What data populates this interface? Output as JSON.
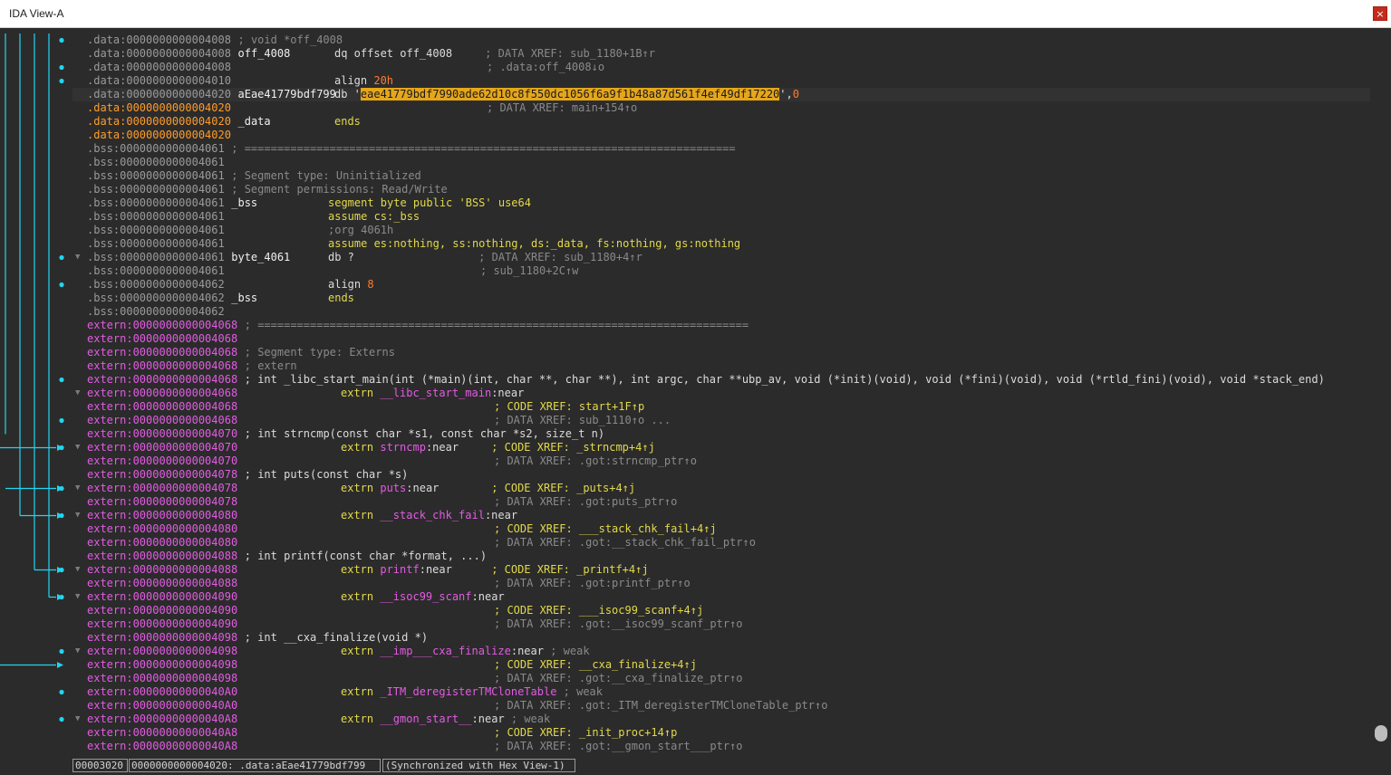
{
  "window": {
    "title": "IDA View-A",
    "close_glyph": "×"
  },
  "arrow_color": "#1fd6f0",
  "lines": [
    {
      "addr": ".data:0000000000004008",
      "addr_style": "data",
      "dot": true,
      "segs": [
        {
          "t": "; void *off_4008",
          "c": "cmt"
        }
      ]
    },
    {
      "addr": ".data:0000000000004008",
      "addr_style": "data",
      "dot": false,
      "label": "off_4008",
      "segs": [
        {
          "t": "dq offset off_4008",
          "c": "mn"
        },
        {
          "t": "; DATA XREF: sub_1180+1B↑r",
          "c": "cmt"
        }
      ]
    },
    {
      "addr": ".data:0000000000004008",
      "addr_style": "data",
      "dot": true,
      "segs": [
        {
          "t": "; .data:off_4008↓o",
          "c": "cmt"
        }
      ]
    },
    {
      "addr": ".data:0000000000004010",
      "addr_style": "data",
      "dot": true,
      "segs": [
        {
          "t": "align ",
          "c": "mn"
        },
        {
          "t": "20h",
          "c": "num"
        }
      ]
    },
    {
      "addr": ".data:0000000000004020",
      "addr_style": "data",
      "dot": false,
      "current": true,
      "label": "aEae41779bdf799",
      "segs": [
        {
          "t": "db '",
          "c": "mn"
        },
        {
          "t": "eae41779bdf7990ade62d10c8f550dc1056f6a9f1b48a87d561f4ef49df17220",
          "c": "hl"
        },
        {
          "t": "',",
          "c": "mn"
        },
        {
          "t": "0",
          "c": "num"
        }
      ]
    },
    {
      "addr": ".data:0000000000004020",
      "addr_style": "orange",
      "dot": false,
      "segs": [
        {
          "t": "; DATA XREF: main+154↑o",
          "c": "cmt"
        }
      ]
    },
    {
      "addr": ".data:0000000000004020",
      "addr_style": "orange",
      "dot": false,
      "label": "_data",
      "segs": [
        {
          "t": "ends",
          "c": "kw"
        }
      ]
    },
    {
      "addr": ".data:0000000000004020",
      "addr_style": "orange",
      "dot": false,
      "segs": []
    },
    {
      "addr": ".bss:0000000000004061",
      "addr_style": "data",
      "dot": false,
      "segs": [
        {
          "t": "; ===========================================================================",
          "c": "cmt"
        }
      ]
    },
    {
      "addr": ".bss:0000000000004061",
      "addr_style": "data",
      "dot": false,
      "segs": []
    },
    {
      "addr": ".bss:0000000000004061",
      "addr_style": "data",
      "dot": false,
      "segs": [
        {
          "t": "; Segment type: Uninitialized",
          "c": "cmt"
        }
      ]
    },
    {
      "addr": ".bss:0000000000004061",
      "addr_style": "data",
      "dot": false,
      "segs": [
        {
          "t": "; Segment permissions: Read/Write",
          "c": "cmt"
        }
      ]
    },
    {
      "addr": ".bss:0000000000004061",
      "addr_style": "data",
      "dot": false,
      "label": "_bss",
      "segs": [
        {
          "t": "segment byte public 'BSS' use64",
          "c": "kw"
        }
      ]
    },
    {
      "addr": ".bss:0000000000004061",
      "addr_style": "data",
      "dot": false,
      "segs": [
        {
          "t": "assume cs:_bss",
          "c": "kw"
        }
      ]
    },
    {
      "addr": ".bss:0000000000004061",
      "addr_style": "data",
      "dot": false,
      "segs": [
        {
          "t": ";org 4061h",
          "c": "cmt"
        }
      ]
    },
    {
      "addr": ".bss:0000000000004061",
      "addr_style": "data",
      "dot": false,
      "segs": [
        {
          "t": "assume es:nothing, ss:nothing, ds:_data, fs:nothing, gs:nothing",
          "c": "kw"
        }
      ]
    },
    {
      "addr": ".bss:0000000000004061",
      "addr_style": "data",
      "dot": true,
      "fold": true,
      "label": "byte_4061",
      "segs": [
        {
          "t": "db ?",
          "c": "mn"
        },
        {
          "t": "; DATA XREF: sub_1180+4↑r",
          "c": "cmt"
        }
      ]
    },
    {
      "addr": ".bss:0000000000004061",
      "addr_style": "data",
      "dot": false,
      "segs": [
        {
          "t": "; sub_1180+2C↑w",
          "c": "cmt"
        }
      ]
    },
    {
      "addr": ".bss:0000000000004062",
      "addr_style": "data",
      "dot": true,
      "segs": [
        {
          "t": "align ",
          "c": "mn"
        },
        {
          "t": "8",
          "c": "num"
        }
      ]
    },
    {
      "addr": ".bss:0000000000004062",
      "addr_style": "data",
      "dot": false,
      "label": "_bss",
      "segs": [
        {
          "t": "ends",
          "c": "kw"
        }
      ]
    },
    {
      "addr": ".bss:0000000000004062",
      "addr_style": "data",
      "dot": false,
      "segs": []
    },
    {
      "addr": "extern:0000000000004068",
      "addr_style": "extern",
      "dot": false,
      "segs": [
        {
          "t": "; ===========================================================================",
          "c": "cmt"
        }
      ]
    },
    {
      "addr": "extern:0000000000004068",
      "addr_style": "extern",
      "dot": false,
      "segs": []
    },
    {
      "addr": "extern:0000000000004068",
      "addr_style": "extern",
      "dot": false,
      "segs": [
        {
          "t": "; Segment type: Externs",
          "c": "cmt"
        }
      ]
    },
    {
      "addr": "extern:0000000000004068",
      "addr_style": "extern",
      "dot": false,
      "segs": [
        {
          "t": "; extern",
          "c": "cmt"
        }
      ]
    },
    {
      "addr": "extern:0000000000004068",
      "addr_style": "extern",
      "dot": true,
      "segs": [
        {
          "t": "; int _libc_start_main(int (*main)(int, char **, char **), int argc, char **ubp_av, void (*init)(void), void (*fini)(void), void (*rtld_fini)(void), void *stack_end)",
          "c": "decl"
        }
      ]
    },
    {
      "addr": "extern:0000000000004068",
      "addr_style": "extern",
      "dot": false,
      "fold": true,
      "segs": [
        {
          "t": "extrn ",
          "c": "kw"
        },
        {
          "t": "__libc_start_main",
          "c": "mag"
        },
        {
          "t": ":near",
          "c": "mn"
        }
      ]
    },
    {
      "addr": "extern:0000000000004068",
      "addr_style": "extern",
      "dot": false,
      "segs": [
        {
          "t": "; CODE XREF: start+1F↑p",
          "c": "xref"
        }
      ]
    },
    {
      "addr": "extern:0000000000004068",
      "addr_style": "extern",
      "dot": true,
      "segs": [
        {
          "t": "; DATA XREF: sub_1110↑o ...",
          "c": "cmt"
        }
      ]
    },
    {
      "addr": "extern:0000000000004070",
      "addr_style": "extern",
      "dot": false,
      "segs": [
        {
          "t": "; int strncmp(const char *s1, const char *s2, size_t n)",
          "c": "decl"
        }
      ]
    },
    {
      "addr": "extern:0000000000004070",
      "addr_style": "extern",
      "dot": true,
      "fold": true,
      "segs": [
        {
          "t": "extrn ",
          "c": "kw"
        },
        {
          "t": "strncmp",
          "c": "mag"
        },
        {
          "t": ":near",
          "c": "mn"
        },
        {
          "t": "; CODE XREF: _strncmp+4↑j",
          "c": "xref"
        }
      ]
    },
    {
      "addr": "extern:0000000000004070",
      "addr_style": "extern",
      "dot": false,
      "segs": [
        {
          "t": "; DATA XREF: .got:strncmp_ptr↑o",
          "c": "cmt"
        }
      ]
    },
    {
      "addr": "extern:0000000000004078",
      "addr_style": "extern",
      "dot": false,
      "segs": [
        {
          "t": "; int puts(const char *s)",
          "c": "decl"
        }
      ]
    },
    {
      "addr": "extern:0000000000004078",
      "addr_style": "extern",
      "dot": true,
      "fold": true,
      "segs": [
        {
          "t": "extrn ",
          "c": "kw"
        },
        {
          "t": "puts",
          "c": "mag"
        },
        {
          "t": ":near",
          "c": "mn"
        },
        {
          "t": "; CODE XREF: _puts+4↑j",
          "c": "xref"
        }
      ]
    },
    {
      "addr": "extern:0000000000004078",
      "addr_style": "extern",
      "dot": false,
      "segs": [
        {
          "t": "; DATA XREF: .got:puts_ptr↑o",
          "c": "cmt"
        }
      ]
    },
    {
      "addr": "extern:0000000000004080",
      "addr_style": "extern",
      "dot": true,
      "fold": true,
      "segs": [
        {
          "t": "extrn ",
          "c": "kw"
        },
        {
          "t": "__stack_chk_fail",
          "c": "mag"
        },
        {
          "t": ":near",
          "c": "mn"
        }
      ]
    },
    {
      "addr": "extern:0000000000004080",
      "addr_style": "extern",
      "dot": false,
      "segs": [
        {
          "t": "; CODE XREF: ___stack_chk_fail+4↑j",
          "c": "xref"
        }
      ]
    },
    {
      "addr": "extern:0000000000004080",
      "addr_style": "extern",
      "dot": false,
      "segs": [
        {
          "t": "; DATA XREF: .got:__stack_chk_fail_ptr↑o",
          "c": "cmt"
        }
      ]
    },
    {
      "addr": "extern:0000000000004088",
      "addr_style": "extern",
      "dot": false,
      "segs": [
        {
          "t": "; int printf(const char *format, ...)",
          "c": "decl"
        }
      ]
    },
    {
      "addr": "extern:0000000000004088",
      "addr_style": "extern",
      "dot": true,
      "fold": true,
      "segs": [
        {
          "t": "extrn ",
          "c": "kw"
        },
        {
          "t": "printf",
          "c": "mag"
        },
        {
          "t": ":near",
          "c": "mn"
        },
        {
          "t": "; CODE XREF: _printf+4↑j",
          "c": "xref"
        }
      ]
    },
    {
      "addr": "extern:0000000000004088",
      "addr_style": "extern",
      "dot": false,
      "segs": [
        {
          "t": "; DATA XREF: .got:printf_ptr↑o",
          "c": "cmt"
        }
      ]
    },
    {
      "addr": "extern:0000000000004090",
      "addr_style": "extern",
      "dot": true,
      "fold": true,
      "segs": [
        {
          "t": "extrn ",
          "c": "kw"
        },
        {
          "t": "__isoc99_scanf",
          "c": "mag"
        },
        {
          "t": ":near",
          "c": "mn"
        }
      ]
    },
    {
      "addr": "extern:0000000000004090",
      "addr_style": "extern",
      "dot": false,
      "segs": [
        {
          "t": "; CODE XREF: ___isoc99_scanf+4↑j",
          "c": "xref"
        }
      ]
    },
    {
      "addr": "extern:0000000000004090",
      "addr_style": "extern",
      "dot": false,
      "segs": [
        {
          "t": "; DATA XREF: .got:__isoc99_scanf_ptr↑o",
          "c": "cmt"
        }
      ]
    },
    {
      "addr": "extern:0000000000004098",
      "addr_style": "extern",
      "dot": false,
      "segs": [
        {
          "t": "; int __cxa_finalize(void *)",
          "c": "decl"
        }
      ]
    },
    {
      "addr": "extern:0000000000004098",
      "addr_style": "extern",
      "dot": true,
      "fold": true,
      "segs": [
        {
          "t": "extrn ",
          "c": "kw"
        },
        {
          "t": "__imp___cxa_finalize",
          "c": "mag"
        },
        {
          "t": ":near ",
          "c": "mn"
        },
        {
          "t": "; weak",
          "c": "cmt"
        }
      ]
    },
    {
      "addr": "extern:0000000000004098",
      "addr_style": "extern",
      "dot": false,
      "segs": [
        {
          "t": "; CODE XREF: __cxa_finalize+4↑j",
          "c": "xref"
        }
      ]
    },
    {
      "addr": "extern:0000000000004098",
      "addr_style": "extern",
      "dot": false,
      "segs": [
        {
          "t": "; DATA XREF: .got:__cxa_finalize_ptr↑o",
          "c": "cmt"
        }
      ]
    },
    {
      "addr": "extern:00000000000040A0",
      "addr_style": "extern",
      "dot": true,
      "segs": [
        {
          "t": "extrn ",
          "c": "kw"
        },
        {
          "t": "_ITM_deregisterTMCloneTable",
          "c": "mag"
        },
        {
          "t": " ; weak",
          "c": "cmt"
        }
      ]
    },
    {
      "addr": "extern:00000000000040A0",
      "addr_style": "extern",
      "dot": false,
      "segs": [
        {
          "t": "; DATA XREF: .got:_ITM_deregisterTMCloneTable_ptr↑o",
          "c": "cmt"
        }
      ]
    },
    {
      "addr": "extern:00000000000040A8",
      "addr_style": "extern",
      "dot": true,
      "fold": true,
      "segs": [
        {
          "t": "extrn ",
          "c": "kw"
        },
        {
          "t": "__gmon_start__",
          "c": "mag"
        },
        {
          "t": ":near ",
          "c": "mn"
        },
        {
          "t": "; weak",
          "c": "cmt"
        }
      ]
    },
    {
      "addr": "extern:00000000000040A8",
      "addr_style": "extern",
      "dot": false,
      "segs": [
        {
          "t": "; CODE XREF: _init_proc+14↑p",
          "c": "xref"
        }
      ]
    },
    {
      "addr": "extern:00000000000040A8",
      "addr_style": "extern",
      "dot": false,
      "segs": [
        {
          "t": "; DATA XREF: .got:__gmon_start___ptr↑o",
          "c": "cmt"
        }
      ]
    }
  ],
  "status": {
    "offset": "00003020",
    "location": "0000000000004020: .data:aEae41779bdf799",
    "sync": "(Synchronized with Hex View-1)"
  }
}
